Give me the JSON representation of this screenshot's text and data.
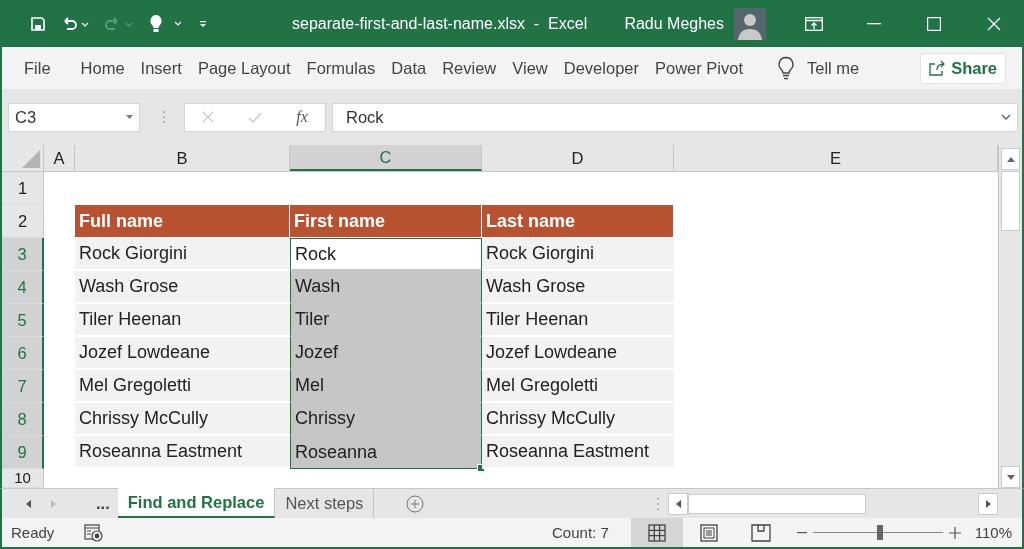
{
  "title_bar": {
    "quick_access": [
      {
        "kind": "save",
        "disabled": false
      },
      {
        "kind": "undo",
        "disabled": false
      },
      {
        "kind": "redo",
        "disabled": true
      },
      {
        "kind": "ideas",
        "disabled": false
      },
      {
        "kind": "customize",
        "disabled": false
      }
    ],
    "title": "separate-first-and-last-name.xlsx  -  Excel",
    "user": "Radu Meghes"
  },
  "ribbon": {
    "tabs": [
      "File",
      "Home",
      "Insert",
      "Page Layout",
      "Formulas",
      "Data",
      "Review",
      "View",
      "Developer",
      "Power Pivot"
    ],
    "tell_me": "Tell me",
    "share": "Share"
  },
  "formula_bar": {
    "name_box": "C3",
    "function_label": "fx",
    "formula": "Rock"
  },
  "grid": {
    "columns": [
      {
        "label": "A",
        "selected": false
      },
      {
        "label": "B",
        "selected": false
      },
      {
        "label": "C",
        "selected": true
      },
      {
        "label": "D",
        "selected": false
      },
      {
        "label": "E",
        "selected": false
      }
    ],
    "rows": [
      {
        "number": "1",
        "selected": false
      },
      {
        "number": "2",
        "selected": false,
        "kind": "header",
        "cells": [
          {
            "text": "Full name",
            "selected": false,
            "active": false
          },
          {
            "text": "First name",
            "selected": false,
            "active": false
          },
          {
            "text": "Last name",
            "selected": false,
            "active": false
          }
        ]
      },
      {
        "number": "3",
        "selected": true,
        "kind": "data",
        "cells": [
          {
            "text": "Rock Giorgini",
            "selected": false,
            "active": false
          },
          {
            "text": "Rock",
            "selected": true,
            "active": true
          },
          {
            "text": "Rock Giorgini",
            "selected": false,
            "active": false
          }
        ]
      },
      {
        "number": "4",
        "selected": true,
        "kind": "data",
        "cells": [
          {
            "text": "Wash Grose",
            "selected": false,
            "active": false
          },
          {
            "text": "Wash",
            "selected": true,
            "active": false
          },
          {
            "text": "Wash Grose",
            "selected": false,
            "active": false
          }
        ]
      },
      {
        "number": "5",
        "selected": true,
        "kind": "data",
        "cells": [
          {
            "text": "Tiler Heenan",
            "selected": false,
            "active": false
          },
          {
            "text": "Tiler",
            "selected": true,
            "active": false
          },
          {
            "text": "Tiler Heenan",
            "selected": false,
            "active": false
          }
        ]
      },
      {
        "number": "6",
        "selected": true,
        "kind": "data",
        "cells": [
          {
            "text": "Jozef Lowdeane",
            "selected": false,
            "active": false
          },
          {
            "text": "Jozef",
            "selected": true,
            "active": false
          },
          {
            "text": "Jozef Lowdeane",
            "selected": false,
            "active": false
          }
        ]
      },
      {
        "number": "7",
        "selected": true,
        "kind": "data",
        "cells": [
          {
            "text": "Mel Gregoletti",
            "selected": false,
            "active": false
          },
          {
            "text": "Mel",
            "selected": true,
            "active": false
          },
          {
            "text": "Mel Gregoletti",
            "selected": false,
            "active": false
          }
        ]
      },
      {
        "number": "8",
        "selected": true,
        "kind": "data",
        "cells": [
          {
            "text": "Chrissy McCully",
            "selected": false,
            "active": false
          },
          {
            "text": "Chrissy",
            "selected": true,
            "active": false
          },
          {
            "text": "Chrissy McCully",
            "selected": false,
            "active": false
          }
        ]
      },
      {
        "number": "9",
        "selected": true,
        "kind": "data",
        "cells": [
          {
            "text": "Roseanna Eastment",
            "selected": false,
            "active": false
          },
          {
            "text": "Roseanna",
            "selected": true,
            "active": false
          },
          {
            "text": "Roseanna Eastment",
            "selected": false,
            "active": false
          }
        ]
      },
      {
        "number": "10",
        "selected": false
      }
    ]
  },
  "sheet_tabs": {
    "overflow": "...",
    "tabs": [
      {
        "label": "Find and Replace",
        "selected": true
      },
      {
        "label": "Next steps",
        "selected": false
      }
    ]
  },
  "status_bar": {
    "mode": "Ready",
    "count": "Count: 7",
    "views": [
      {
        "kind": "normal",
        "selected": true
      },
      {
        "kind": "page_layout",
        "selected": false
      },
      {
        "kind": "page_break",
        "selected": false
      }
    ],
    "zoom": {
      "level": 0.52,
      "label": "110%"
    }
  }
}
